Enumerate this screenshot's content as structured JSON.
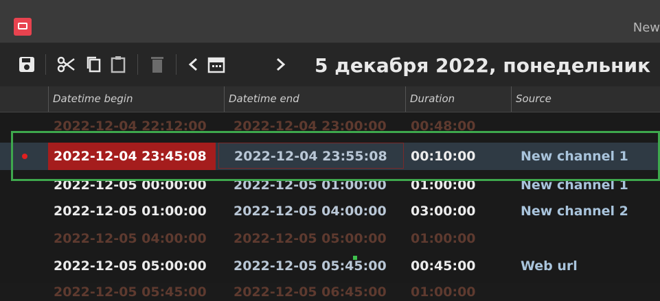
{
  "window": {
    "title": "New"
  },
  "toolbar": {
    "save_icon": "save-icon",
    "cut_icon": "cut-icon",
    "copy_icon": "copy-icon",
    "paste_icon": "paste-icon",
    "delete_icon": "delete-icon",
    "prev_icon": "chevron-left-icon",
    "calendar_icon": "calendar-icon",
    "next_icon": "chevron-right-icon",
    "date_label": "5 декабря 2022, понедельник"
  },
  "table": {
    "columns": [
      "Datetime begin",
      "Datetime end",
      "Duration",
      "Source"
    ],
    "rows": [
      {
        "begin": "2022-12-04 22:12:00",
        "end": "2022-12-04 23:00:00",
        "duration": "00:48:00",
        "source": "",
        "style": "faded"
      },
      {
        "begin": "2022-12-04 23:45:08",
        "end": "2022-12-04 23:55:08",
        "duration": "00:10:00",
        "source": "New channel 1",
        "style": "selected"
      },
      {
        "begin": "2022-12-05 00:00:00",
        "end": "2022-12-05 01:00:00",
        "duration": "01:00:00",
        "source": "New channel 1",
        "style": "white"
      },
      {
        "begin": "2022-12-05 01:00:00",
        "end": "2022-12-05 04:00:00",
        "duration": "03:00:00",
        "source": "New channel 2",
        "style": "white"
      },
      {
        "begin": "2022-12-05 04:00:00",
        "end": "2022-12-05 05:00:00",
        "duration": "01:00:00",
        "source": "",
        "style": "faded"
      },
      {
        "begin": "2022-12-05 05:00:00",
        "end": "2022-12-05 05:45:00",
        "duration": "00:45:00",
        "source": "Web url",
        "style": "white"
      },
      {
        "begin": "2022-12-05 05:45:00",
        "end": "2022-12-05 06:45:00",
        "duration": "01:00:00",
        "source": "",
        "style": "faded"
      }
    ]
  },
  "colors": {
    "accent": "#e8434f",
    "selection": "#a51d1d",
    "highlight_box": "#3ea84d"
  }
}
